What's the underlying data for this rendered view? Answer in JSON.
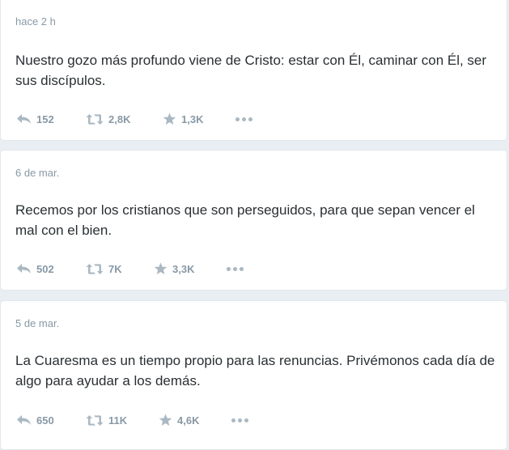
{
  "colors": {
    "background": "#e9eef2",
    "card": "#ffffff",
    "text": "#292f33",
    "muted": "#8899a6",
    "icon": "#aab8c2"
  },
  "tweets": [
    {
      "timestamp": "hace 2 h",
      "text": "Nuestro gozo más profundo viene de Cristo: estar con Él, caminar con Él, ser sus discípulos.",
      "replies": "152",
      "retweets": "2,8K",
      "favorites": "1,3K"
    },
    {
      "timestamp": "6 de mar.",
      "text": "Recemos por los cristianos que son perseguidos, para que sepan vencer el mal con el bien.",
      "replies": "502",
      "retweets": "7K",
      "favorites": "3,3K"
    },
    {
      "timestamp": "5 de mar.",
      "text": "La Cuaresma es un tiempo propio para las renuncias. Privémonos cada día de algo para ayudar a los demás.",
      "replies": "650",
      "retweets": "11K",
      "favorites": "4,6K"
    }
  ],
  "icons": {
    "reply": "reply-arrow-icon",
    "retweet": "retweet-icon",
    "favorite": "star-icon",
    "more": "more-dots-icon"
  }
}
